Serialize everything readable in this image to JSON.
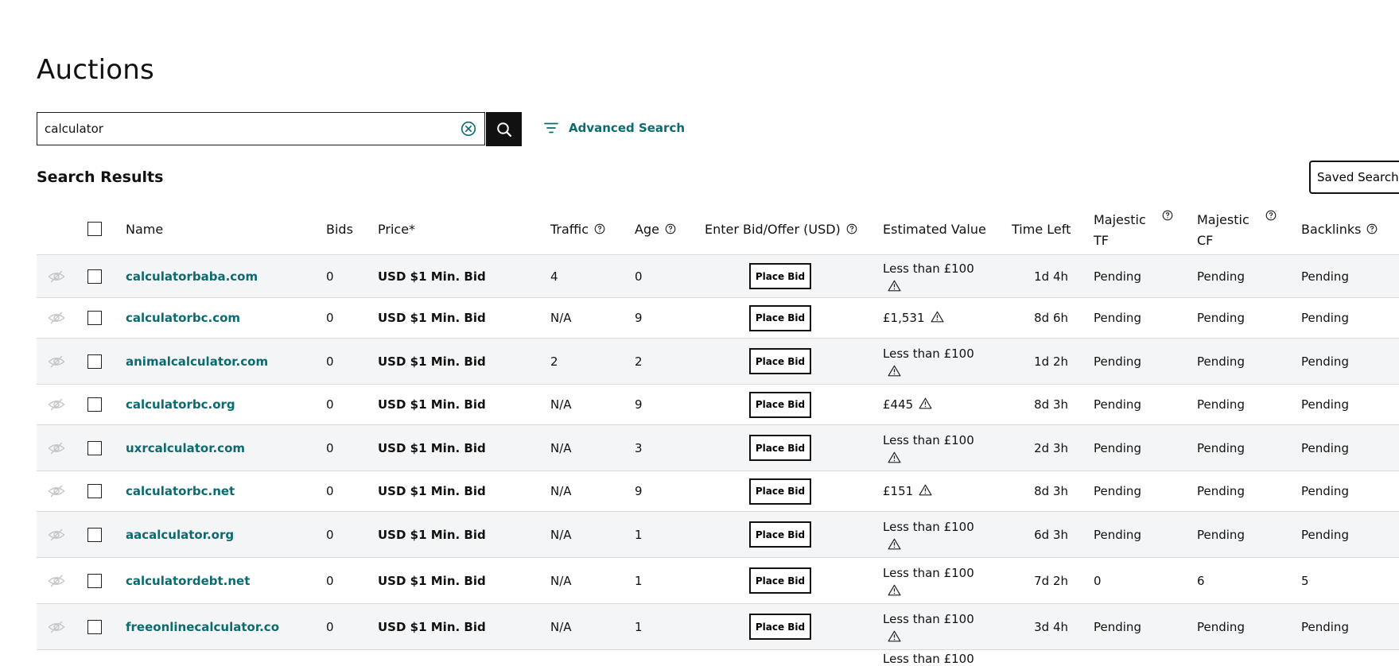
{
  "page": {
    "title": "Auctions"
  },
  "search": {
    "value": "calculator",
    "clear_icon": "circle-x-icon",
    "button_icon": "search-icon",
    "advanced_label": "Advanced Search"
  },
  "results": {
    "title": "Search Results",
    "saved_searches_label": "Saved Searches"
  },
  "colors": {
    "accent": "#0a6b70",
    "row_alt": "#f4f5f6",
    "dark": "#111111"
  },
  "table": {
    "columns": {
      "name": "Name",
      "bids": "Bids",
      "price": "Price*",
      "traffic": "Traffic",
      "age": "Age",
      "bid": "Enter Bid/Offer (USD)",
      "value": "Estimated Value",
      "time": "Time Left",
      "tf_line1": "Majestic",
      "tf_line2": "TF",
      "cf_line1": "Majestic",
      "cf_line2": "CF",
      "backlinks": "Backlinks"
    },
    "place_bid_label": "Place Bid",
    "rows": [
      {
        "name": "calculatorbaba.com",
        "bids": "0",
        "price": "USD $1 Min. Bid",
        "traffic": "4",
        "age": "0",
        "value": "Less than £100",
        "time": "1d 4h",
        "tf": "Pending",
        "cf": "Pending",
        "backlinks": "Pending"
      },
      {
        "name": "calculatorbc.com",
        "bids": "0",
        "price": "USD $1 Min. Bid",
        "traffic": "N/A",
        "age": "9",
        "value": "£1,531",
        "time": "8d 6h",
        "tf": "Pending",
        "cf": "Pending",
        "backlinks": "Pending"
      },
      {
        "name": "animalcalculator.com",
        "bids": "0",
        "price": "USD $1 Min. Bid",
        "traffic": "2",
        "age": "2",
        "value": "Less than £100",
        "time": "1d 2h",
        "tf": "Pending",
        "cf": "Pending",
        "backlinks": "Pending"
      },
      {
        "name": "calculatorbc.org",
        "bids": "0",
        "price": "USD $1 Min. Bid",
        "traffic": "N/A",
        "age": "9",
        "value": "£445",
        "time": "8d 3h",
        "tf": "Pending",
        "cf": "Pending",
        "backlinks": "Pending"
      },
      {
        "name": "uxrcalculator.com",
        "bids": "0",
        "price": "USD $1 Min. Bid",
        "traffic": "N/A",
        "age": "3",
        "value": "Less than £100",
        "time": "2d 3h",
        "tf": "Pending",
        "cf": "Pending",
        "backlinks": "Pending"
      },
      {
        "name": "calculatorbc.net",
        "bids": "0",
        "price": "USD $1 Min. Bid",
        "traffic": "N/A",
        "age": "9",
        "value": "£151",
        "time": "8d 3h",
        "tf": "Pending",
        "cf": "Pending",
        "backlinks": "Pending"
      },
      {
        "name": "aacalculator.org",
        "bids": "0",
        "price": "USD $1 Min. Bid",
        "traffic": "N/A",
        "age": "1",
        "value": "Less than £100",
        "time": "6d 3h",
        "tf": "Pending",
        "cf": "Pending",
        "backlinks": "Pending"
      },
      {
        "name": "calculatordebt.net",
        "bids": "0",
        "price": "USD $1 Min. Bid",
        "traffic": "N/A",
        "age": "1",
        "value": "Less than £100",
        "time": "7d 2h",
        "tf": "0",
        "cf": "6",
        "backlinks": "5"
      },
      {
        "name": "freeonlinecalculator.co",
        "bids": "0",
        "price": "USD $1 Min. Bid",
        "traffic": "N/A",
        "age": "1",
        "value": "Less than £100",
        "time": "3d 4h",
        "tf": "Pending",
        "cf": "Pending",
        "backlinks": "Pending"
      }
    ],
    "partial_next_value": "Less than £100"
  }
}
